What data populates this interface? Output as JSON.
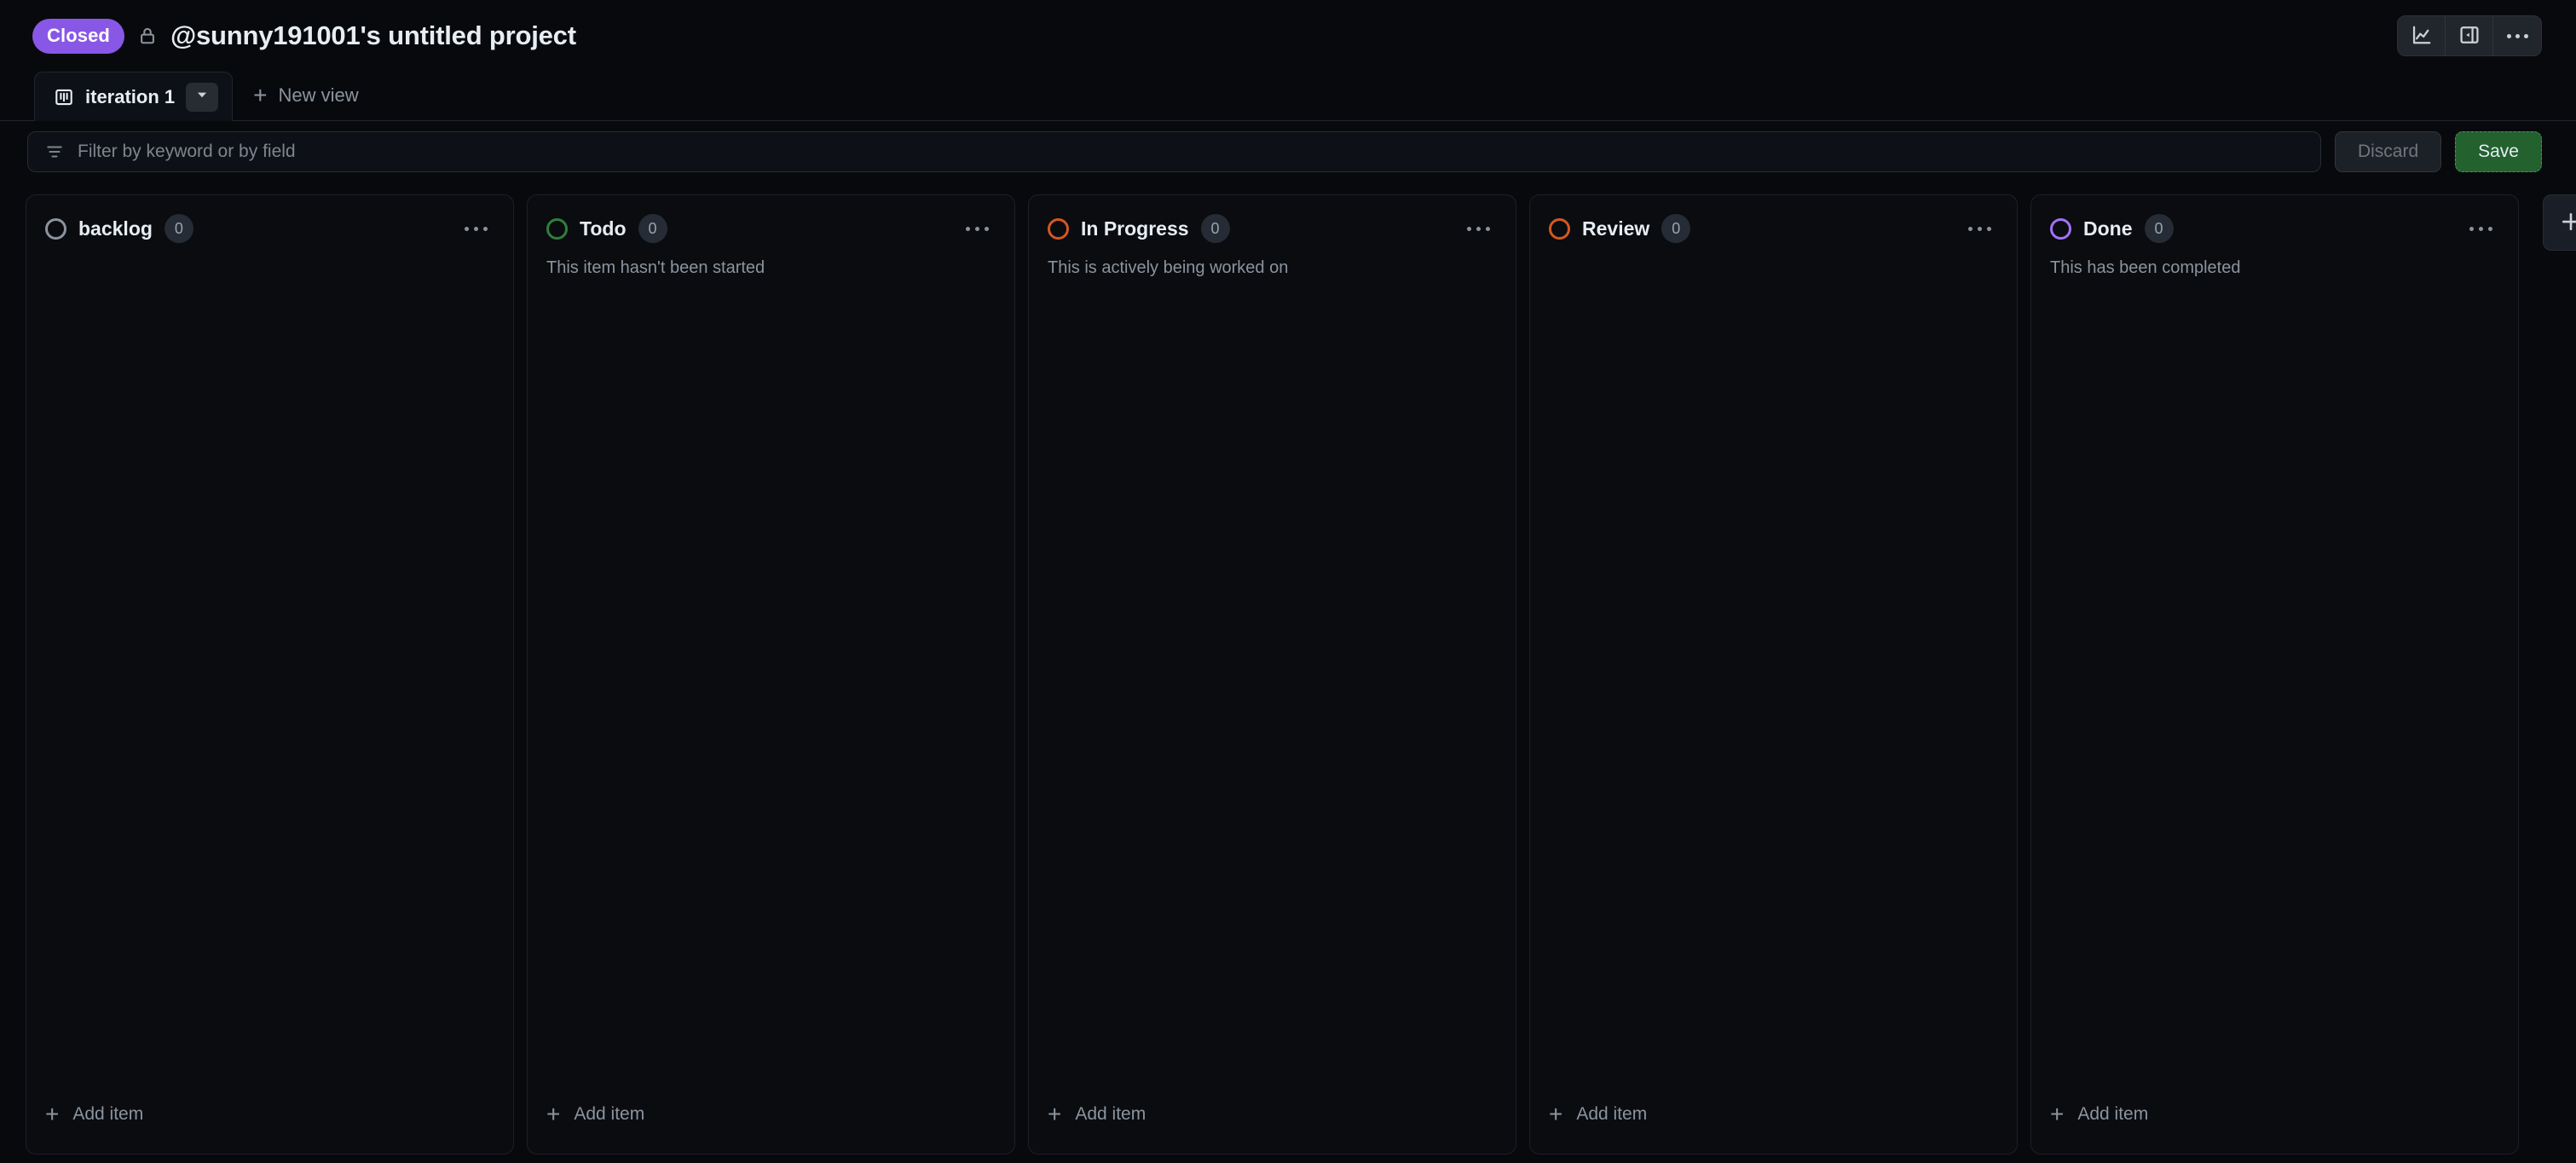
{
  "header": {
    "status_badge": "Closed",
    "visibility_icon": "lock-icon",
    "title": "@sunny191001's untitled project",
    "actions": [
      {
        "icon": "insights-chart-icon",
        "name": "insights-button"
      },
      {
        "icon": "side-panel-icon",
        "name": "toggle-side-panel-button"
      },
      {
        "icon": "kebab-menu-icon",
        "name": "project-more-menu-button"
      }
    ]
  },
  "tabs": {
    "active": {
      "icon": "board-view-icon",
      "label": "iteration 1",
      "caret_icon": "chevron-down-icon"
    },
    "new_view_label": "New view",
    "new_view_icon": "plus-icon"
  },
  "filter": {
    "icon": "filter-icon",
    "placeholder": "Filter by keyword or by field",
    "value": "",
    "discard_label": "Discard",
    "save_label": "Save"
  },
  "board": {
    "add_item_label": "Add item",
    "add_item_icon": "plus-icon",
    "add_column_icon": "plus-icon",
    "column_menu_icon": "kebab-menu-icon",
    "columns": [
      {
        "title": "backlog",
        "count": "0",
        "description": "",
        "color": "#8b949e",
        "status_icon": "status-circle-gray"
      },
      {
        "title": "Todo",
        "count": "0",
        "description": "This item hasn't been started",
        "color": "#2f7f3d",
        "status_icon": "status-circle-green"
      },
      {
        "title": "In Progress",
        "count": "0",
        "description": "This is actively being worked on",
        "color": "#d4571f",
        "status_icon": "status-circle-orange"
      },
      {
        "title": "Review",
        "count": "0",
        "description": "",
        "color": "#d4571f",
        "status_icon": "status-circle-orange"
      },
      {
        "title": "Done",
        "count": "0",
        "description": "This has been completed",
        "color": "#a371f7",
        "status_icon": "status-circle-purple"
      }
    ]
  },
  "colors": {
    "page_bg": "#08090d",
    "column_bg": "#0a0c10",
    "border": "#1b2028",
    "accent_purple": "#8957e5",
    "save_green": "#23612f",
    "text_primary": "#e6edf3",
    "text_muted": "#8b949e"
  }
}
